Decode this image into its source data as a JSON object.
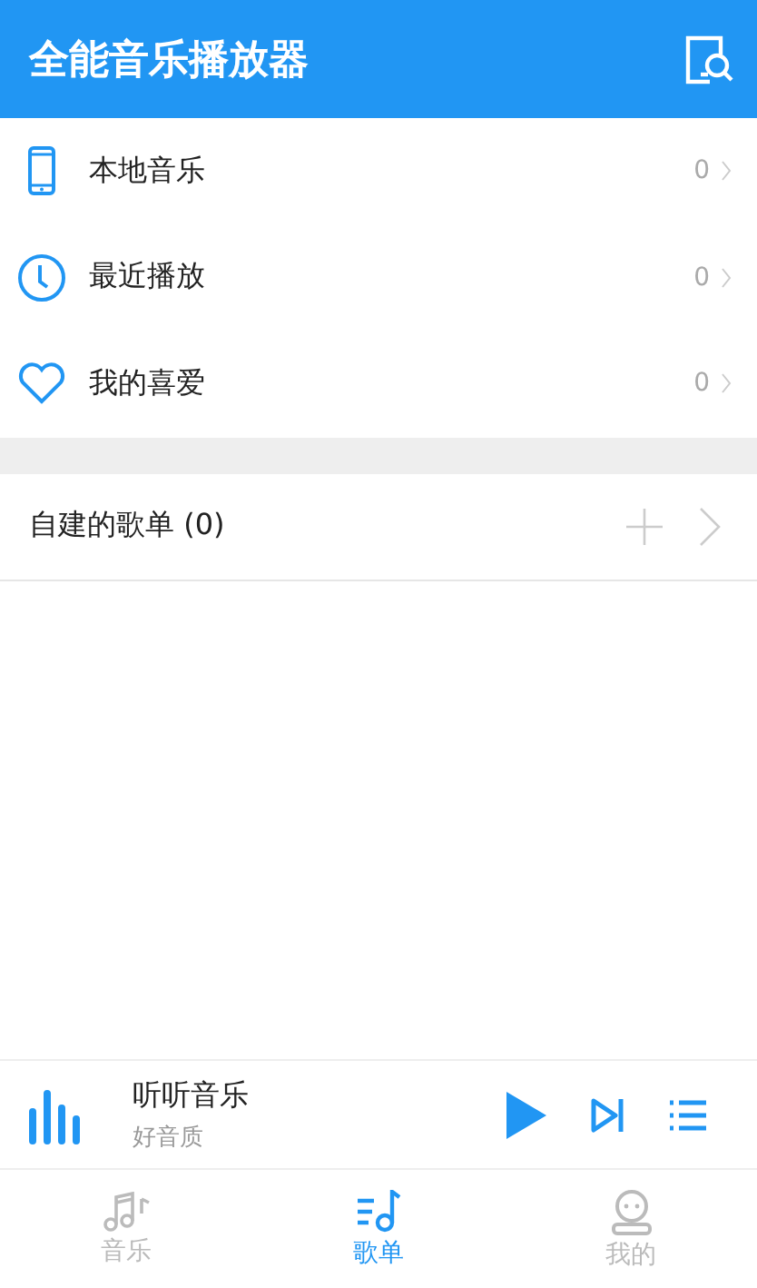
{
  "app_bar": {
    "title": "全能音乐播放器"
  },
  "library": [
    {
      "kind": "phone",
      "label": "本地音乐",
      "count": "0"
    },
    {
      "kind": "clock",
      "label": "最近播放",
      "count": "0"
    },
    {
      "kind": "heart",
      "label": "我的喜爱",
      "count": "0"
    }
  ],
  "playlists": {
    "title": "自建的歌单 (0)"
  },
  "player": {
    "title": "听听音乐",
    "subtitle": "好音质"
  },
  "tabs": [
    {
      "kind": "music",
      "label": "音乐",
      "selected": false
    },
    {
      "kind": "playlist",
      "label": "歌单",
      "selected": true
    },
    {
      "kind": "me",
      "label": "我的",
      "selected": false
    }
  ]
}
